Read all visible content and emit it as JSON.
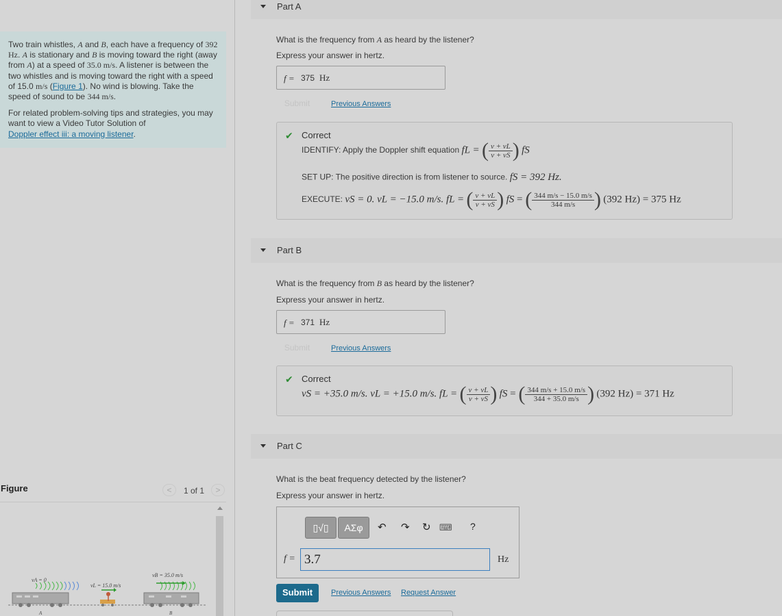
{
  "problem": {
    "para1_a": "Two train whistles, ",
    "A": "A",
    "and": " and ",
    "B": "B",
    "para1_b": ", each have a frequency of",
    "freq": "392 Hz",
    "para1_c": ". ",
    "para1_d": " is stationary and ",
    "para1_e": " is moving toward the right (away from ",
    "para1_f": ") at a speed of ",
    "speedB": "35.0 m/s",
    "para1_g": ". A listener is between the two whistles and is moving toward the right with a speed of 15.0 ",
    "ms": "m/s",
    "para1_h": " (",
    "figure_link": "Figure 1",
    "para1_i": "). No wind is blowing. Take the speed of sound to be ",
    "sound_speed": "344 m/s",
    "para1_j": ".",
    "para2": "For related problem-solving tips and strategies, you may want to view a Video Tutor Solution of",
    "video_link": "Doppler effect iii: a moving listener",
    "para2_end": "."
  },
  "figure": {
    "title": "Figure",
    "counter": "1 of 1",
    "prev": "<",
    "next": ">",
    "labels": {
      "vA": "vA = 0",
      "vL": "vL = 15.0 m/s",
      "vB": "vB = 35.0 m/s",
      "A": "A",
      "B": "B"
    }
  },
  "partA": {
    "title": "Part A",
    "question_a": "What is the frequency from ",
    "question_var": "A",
    "question_b": " as heard by the listener?",
    "instruction": "Express your answer in hertz.",
    "answer_label": "f =",
    "answer_value": "375",
    "answer_unit": "Hz",
    "submit": "Submit",
    "previous_answers": "Previous Answers",
    "feedback_title": "Correct",
    "identify": "IDENTIFY: Apply the Doppler shift equation ",
    "setup": "SET UP: The positive direction is from listener to source. ",
    "setup_math": "fS = 392 Hz.",
    "execute": "EXECUTE: ",
    "execute_math": "vS = 0. vL = −15.0 m/s. fL =",
    "result_num": "344 m/s − 15.0 m/s",
    "result_den": "344 m/s",
    "result_tail": "(392 Hz) = 375 Hz"
  },
  "partB": {
    "title": "Part B",
    "question_a": "What is the frequency from ",
    "question_var": "B",
    "question_b": " as heard by the listener?",
    "instruction": "Express your answer in hertz.",
    "answer_label": "f =",
    "answer_value": "371",
    "answer_unit": "Hz",
    "submit": "Submit",
    "previous_answers": "Previous Answers",
    "feedback_title": "Correct",
    "line_math": "vS = +35.0 m/s. vL = +15.0 m/s. fL =",
    "result_num": "344 m/s + 15.0 m/s",
    "result_den": "344 + 35.0 m/s",
    "result_tail": "(392 Hz) = 371 Hz"
  },
  "partC": {
    "title": "Part C",
    "question": "What is the beat frequency detected by the listener?",
    "instruction": "Express your answer in hertz.",
    "toolbar": {
      "templates": "▯√▯",
      "symbols": "ΑΣφ",
      "undo": "↶",
      "redo": "↷",
      "reset": "↻",
      "keyboard": "⌨",
      "help": "?"
    },
    "answer_label": "f =",
    "answer_value": "3.7",
    "answer_unit": "Hz",
    "submit": "Submit",
    "previous_answers": "Previous Answers",
    "request_answer": "Request Answer"
  },
  "formula": {
    "fL": "fL =",
    "num": "v + vL",
    "den": "v + vS",
    "fS": "fS"
  },
  "colors": {
    "link": "#1b6b9a",
    "correct": "#2e8b34",
    "submit": "#1d6a8c"
  }
}
